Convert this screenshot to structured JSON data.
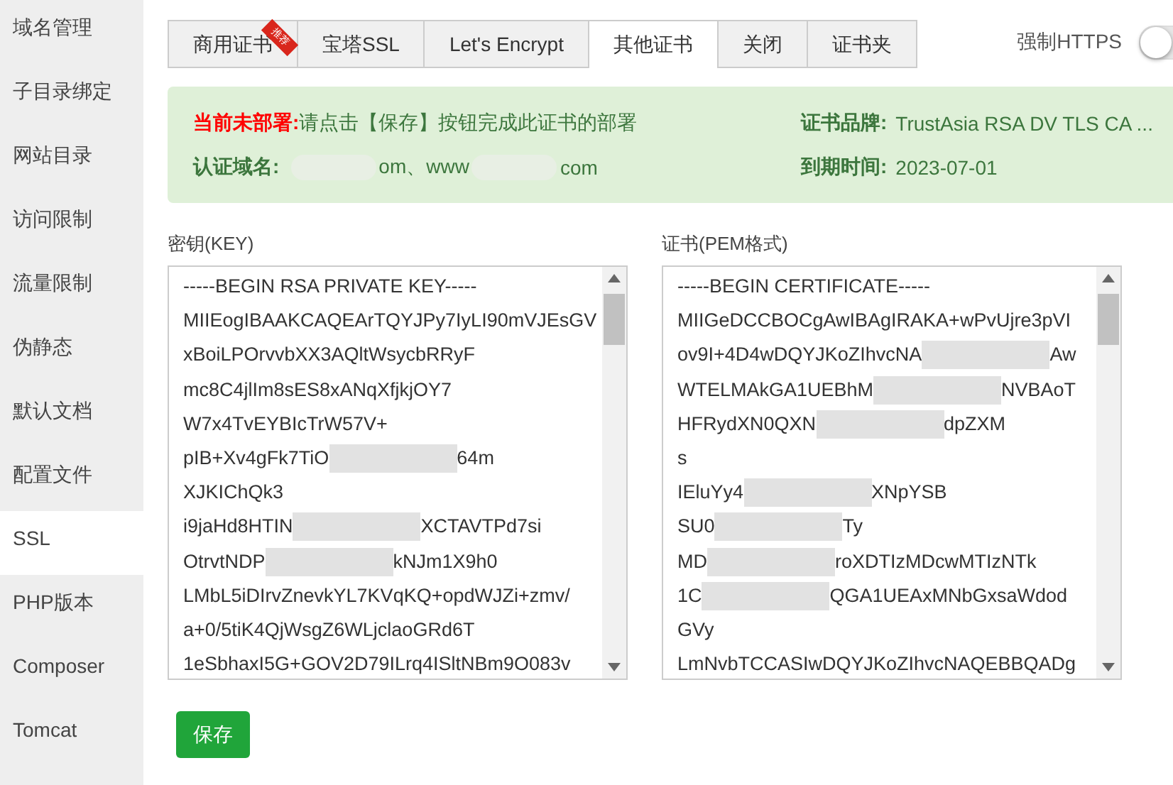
{
  "sidebar": {
    "items": [
      {
        "label": "域名管理",
        "selected": false
      },
      {
        "label": "子目录绑定",
        "selected": false
      },
      {
        "label": "网站目录",
        "selected": false
      },
      {
        "label": "访问限制",
        "selected": false
      },
      {
        "label": "流量限制",
        "selected": false
      },
      {
        "label": "伪静态",
        "selected": false
      },
      {
        "label": "默认文档",
        "selected": false
      },
      {
        "label": "配置文件",
        "selected": false
      },
      {
        "label": "SSL",
        "selected": true
      },
      {
        "label": "PHP版本",
        "selected": false
      },
      {
        "label": "Composer",
        "selected": false
      },
      {
        "label": "Tomcat",
        "selected": false
      }
    ]
  },
  "tabs": [
    {
      "label": "商用证书",
      "selected": false,
      "badge": "推荐"
    },
    {
      "label": "宝塔SSL",
      "selected": false
    },
    {
      "label": "Let's Encrypt",
      "selected": false
    },
    {
      "label": "其他证书",
      "selected": true
    },
    {
      "label": "关闭",
      "selected": false
    },
    {
      "label": "证书夹",
      "selected": false
    }
  ],
  "force_https": {
    "label": "强制HTTPS",
    "on": false
  },
  "status": {
    "label": "当前未部署:",
    "message": "请点击【保存】按钮完成此证书的部署",
    "domain_label": "认证域名:",
    "domain_parts": [
      "om、www",
      "com"
    ],
    "brand_label": "证书品牌:",
    "brand": "TrustAsia RSA DV TLS CA ...",
    "expiry_label": "到期时间:",
    "expiry": "2023-07-01"
  },
  "key": {
    "label": "密钥(KEY)",
    "lines": [
      [
        "-----BEGIN RSA PRIVATE KEY-----"
      ],
      [
        "MIIEogIBAAKCAQEArTQYJPy7IyLI90mVJEsGV"
      ],
      [
        "xBoiLPOrvvbXX3AQltWsycbRRyF"
      ],
      [
        "mc8C4jlIm8sES8xANqXfjkjOY7"
      ],
      [
        "W7x4TvEYBIcTrW57V+"
      ],
      [
        "pIB+Xv4gFk7TiO",
        "64m"
      ],
      [
        "XJKIChQk3"
      ],
      [
        "i9jaHd8HTIN",
        "XCTAVTPd7si"
      ],
      [
        "OtrvtNDP",
        "kNJm1X9h0"
      ],
      [
        "LMbL5iDIrvZnevkYL7KVqKQ+opdWJZi+zmv/"
      ],
      [
        "a+0/5tiK4QjWsgZ6WLjclaoGRd6T"
      ],
      [
        "1eSbhaxI5G+GOV2D79ILrq4ISltNBm9O083v"
      ]
    ]
  },
  "cert": {
    "label": "证书(PEM格式)",
    "lines": [
      [
        "-----BEGIN CERTIFICATE-----"
      ],
      [
        "MIIGeDCCBOCgAwIBAgIRAKA+wPvUjre3pVI"
      ],
      [
        "ov9I+4D4wDQYJKoZIhvcNA",
        "Aw"
      ],
      [
        "WTELMAkGA1UEBhM",
        "NVBAoT"
      ],
      [
        "HFRydXN0QXN",
        "dpZXM"
      ],
      [
        "s"
      ],
      [
        "IEluYy4",
        "XNpYSB"
      ],
      [
        "SU0",
        "Ty"
      ],
      [
        "MD",
        "roXDTIzMDcwMTIzNTk"
      ],
      [
        "1C",
        "QGA1UEAxMNbGxsaWdod"
      ],
      [
        "GVy"
      ],
      [
        "LmNvbTCCASIwDQYJKoZIhvcNAQEBBQADg"
      ]
    ]
  },
  "save_button": "保存"
}
